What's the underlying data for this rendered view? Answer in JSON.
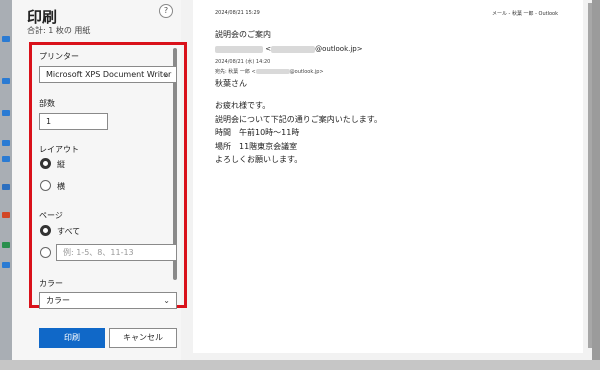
{
  "panel": {
    "title": "印刷",
    "subtitle": "合計: 1 枚の 用紙",
    "help": "?",
    "printer": {
      "label": "プリンター",
      "value": "Microsoft XPS Document Writer"
    },
    "copies": {
      "label": "部数",
      "value": "1"
    },
    "layout": {
      "label": "レイアウト",
      "portrait": "縦",
      "landscape": "横"
    },
    "pages": {
      "label": "ページ",
      "all": "すべて",
      "range_placeholder": "例: 1-5、8、11-13"
    },
    "color": {
      "label": "カラー",
      "value": "カラー"
    },
    "buttons": {
      "print": "印刷",
      "cancel": "キャンセル"
    }
  },
  "preview": {
    "date": "2024/08/21 15:29",
    "header": "メール - 秋葉 一郎 - Outlook",
    "subject": "説明会のご案内",
    "from_suffix": "@outlook.jp>",
    "sent": "2024/08/21 (水) 14:20",
    "to_prefix": "宛先: 秋葉 一郎 <",
    "to_suffix": "@outlook.jp>",
    "greeting": "秋葉さん",
    "body": [
      "お疲れ様です。",
      "説明会について下記の通りご案内いたします。",
      "時間　午前10時～11時",
      "場所　11階東京会議室",
      "よろしくお願いします。"
    ]
  },
  "colors": {
    "accent": "#1068c8",
    "highlight": "#d9111a"
  }
}
